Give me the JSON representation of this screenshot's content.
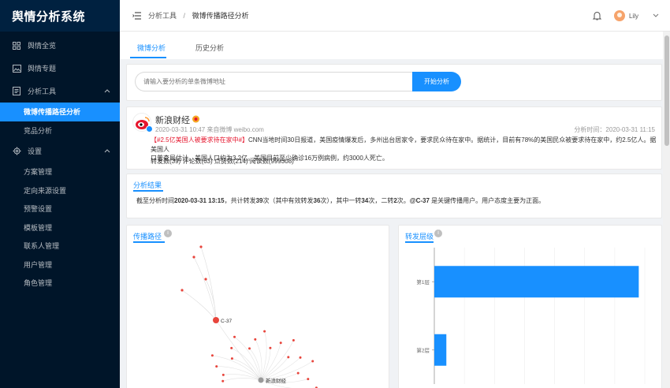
{
  "sidebar": {
    "title": "舆情分析系统",
    "items": [
      {
        "label": "舆情全览"
      },
      {
        "label": "舆情专题"
      },
      {
        "label": "分析工具"
      },
      {
        "label": "微博传播路径分析"
      },
      {
        "label": "竞品分析"
      },
      {
        "label": "设置"
      },
      {
        "label": "方案管理"
      },
      {
        "label": "定向来源设置"
      },
      {
        "label": "预警设置"
      },
      {
        "label": "模板管理"
      },
      {
        "label": "联系人管理"
      },
      {
        "label": "用户管理"
      },
      {
        "label": "角色管理"
      }
    ]
  },
  "header": {
    "breadcrumb": [
      "分析工具",
      "微博传播路径分析"
    ],
    "separator": "/",
    "username": "Lily"
  },
  "tabs": [
    {
      "label": "微博分析"
    },
    {
      "label": "历史分析"
    }
  ],
  "search": {
    "placeholder": "请输入要分析的单条微博地址",
    "button": "开始分析"
  },
  "post": {
    "author": "新浪财经",
    "meta": "2020-03-31 10:47 来自微博 weibo.com",
    "analysis_time": "分析时间：2020-03-31 11:15",
    "text_highlight": "【#2.5亿美国人被要求待在家中#】",
    "text_line1": "CNN当地时间30日报道，美国疫情爆发后，多州出台居家令，要求民众待在家中。据统计，目前有78%的美国民众被要求待在家中，约2.5亿人。据美国人",
    "text_line2": "口普查局估计，美国人口约为3.2亿。美国目前至少确诊16万例病例，约3000人死亡。",
    "stats": "转发数(39) 评论数(63) 点赞数(214) 阅读数(999308)"
  },
  "result": {
    "title": "分析结果",
    "t1": "截至分析时间",
    "time": "2020-03-31 13:15",
    "t2": "，共计转发",
    "n1": "39",
    "t3": "次（其中有效转发",
    "n2": "36",
    "t4": "次），其中一转",
    "n3": "34",
    "t5": "次，二转",
    "n4": "2",
    "t6": "次。",
    "key_user": "@C-37",
    "t7": " 是关键传播用户。用户态度主要为正面。"
  },
  "panels": {
    "path_title": "传播路径",
    "levels_title": "转发层级"
  },
  "colors": {
    "accent": "#1890ff",
    "sidebar": "#001529",
    "node_red": "#e8453c",
    "node_grey": "#999999"
  },
  "chart_data": [
    {
      "type": "network",
      "title": "传播路径",
      "nodes": [
        {
          "name": "新浪财经"
        },
        {
          "name": "C-37"
        }
      ],
      "labels": [
        "C-37",
        "新浪财经"
      ]
    },
    {
      "type": "bar",
      "orientation": "horizontal",
      "title": "转发层级",
      "categories": [
        "第1层",
        "第2层"
      ],
      "values": [
        34,
        2
      ],
      "xlim": [
        0,
        35
      ],
      "xticks": [
        0,
        5,
        10,
        15,
        20,
        25,
        30,
        35
      ]
    }
  ]
}
